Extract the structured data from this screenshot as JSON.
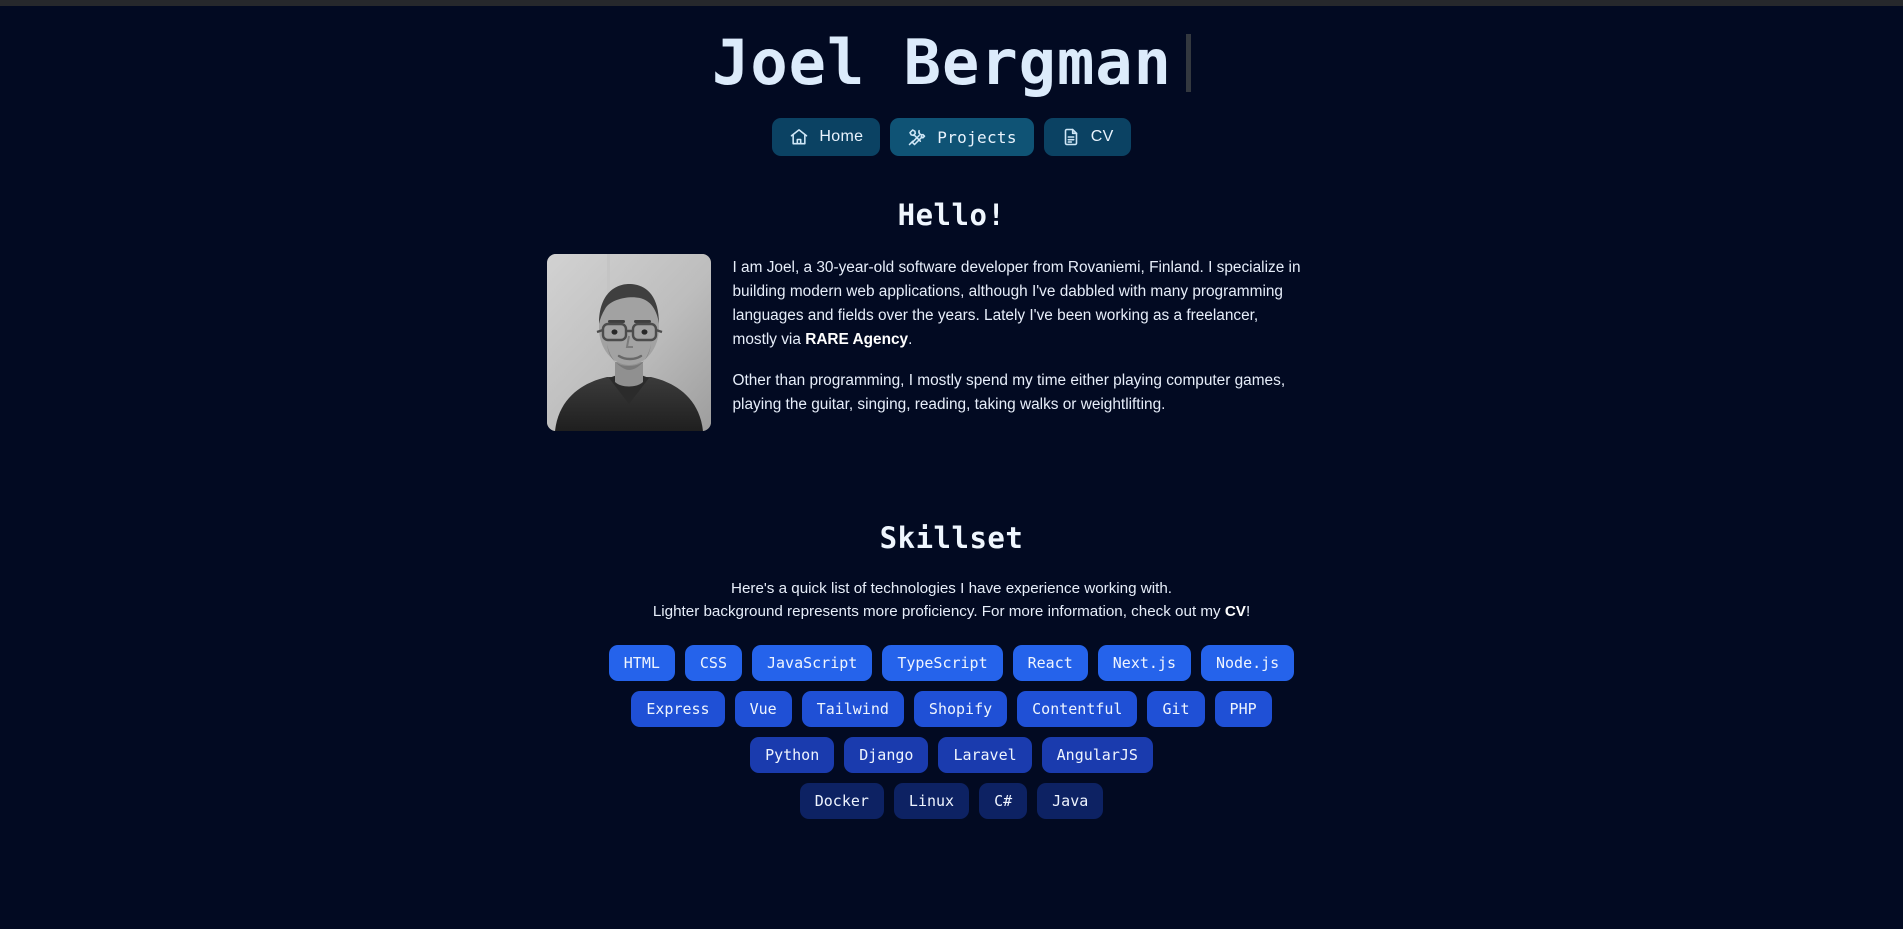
{
  "site": {
    "title": "Joel Bergman",
    "caret": "|"
  },
  "nav": {
    "items": [
      {
        "label": "Home",
        "icon": "house-icon",
        "active": false,
        "mono": false
      },
      {
        "label": "Projects",
        "icon": "hammer-wrench-icon",
        "active": true,
        "mono": true
      },
      {
        "label": "CV",
        "icon": "document-icon",
        "active": false,
        "mono": false
      }
    ]
  },
  "hello": {
    "heading": "Hello!",
    "avatar_alt": "Portrait photo of Joel Bergman",
    "paragraph1_pre": "I am Joel, a 30-year-old software developer from Rovaniemi, Finland. I specialize in building modern web applications, although I've dabbled with many programming languages and fields over the years. Lately I've been working as a freelancer, mostly via ",
    "paragraph1_link": "RARE Agency",
    "paragraph1_post": ".",
    "paragraph2": "Other than programming, I mostly spend my time either playing computer games, playing the guitar, singing, reading, taking walks or weightlifting."
  },
  "skills": {
    "heading": "Skillset",
    "desc_line1": "Here's a quick list of technologies I have experience working with.",
    "desc_line2_pre": "Lighter background represents more proficiency. For more information, check out my ",
    "desc_line2_link": "CV",
    "desc_line2_post": "!",
    "levels": {
      "level1": "#2563eb",
      "level2": "#1f50d6",
      "level3": "#1a3bae",
      "level4": "#0d2263"
    },
    "rows": [
      {
        "color": "#2563eb",
        "tags": [
          "HTML",
          "CSS",
          "JavaScript",
          "TypeScript",
          "React",
          "Next.js",
          "Node.js"
        ]
      },
      {
        "color": "#1f50d6",
        "tags": [
          "Express",
          "Vue",
          "Tailwind",
          "Shopify",
          "Contentful",
          "Git",
          "PHP"
        ]
      },
      {
        "color": "#1a3bae",
        "tags": [
          "Python",
          "Django",
          "Laravel",
          "AngularJS"
        ]
      },
      {
        "color": "#0d2263",
        "tags": [
          "Docker",
          "Linux",
          "C#",
          "Java"
        ]
      }
    ]
  },
  "theme": {
    "background": "#020a22",
    "nav_button": "#0b4263",
    "nav_button_active": "#0f5375",
    "text": "#e8f0fb"
  }
}
